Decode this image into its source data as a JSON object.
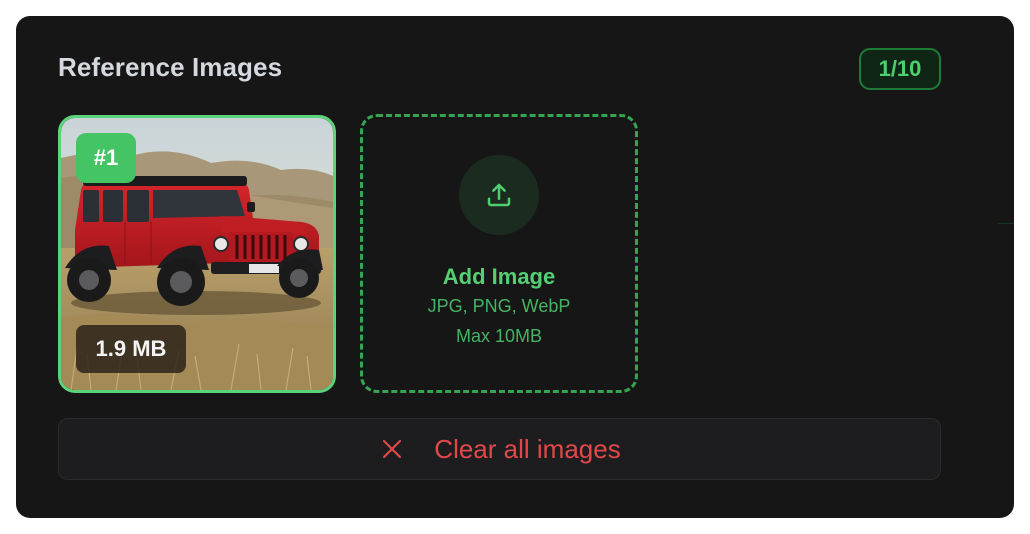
{
  "panel": {
    "title": "Reference Images",
    "count_badge": "1/10"
  },
  "images": [
    {
      "index_label": "#1",
      "size_label": "1.9 MB",
      "alt": "Red Jeep Wrangler on a dry grassy hillside"
    }
  ],
  "add_tile": {
    "label": "Add Image",
    "formats": "JPG, PNG, WebP",
    "max_size": "Max 10MB",
    "icon": "upload-icon"
  },
  "clear_button": {
    "label": "Clear all images",
    "icon": "close-icon"
  },
  "colors": {
    "accent_green": "#4ecf6e",
    "danger_red": "#e2484a",
    "panel_bg": "#161617"
  }
}
